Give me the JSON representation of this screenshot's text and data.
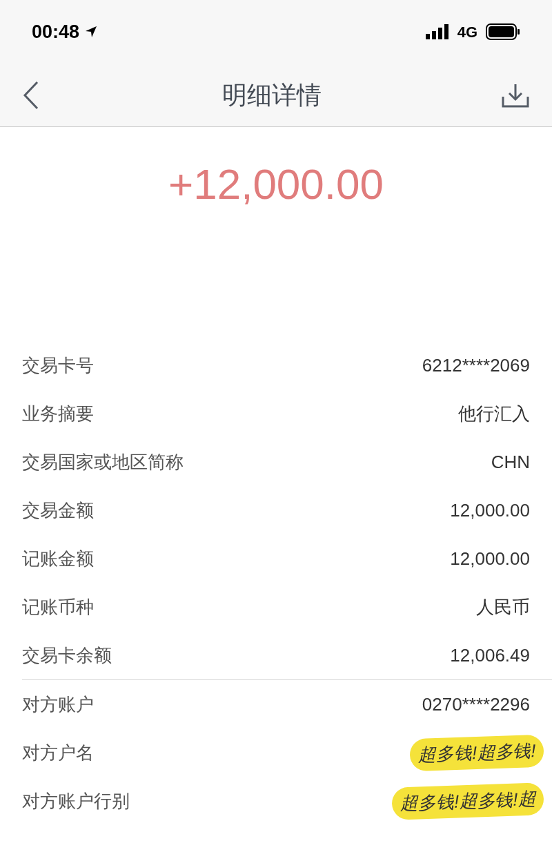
{
  "status_bar": {
    "time": "00:48",
    "network": "4G"
  },
  "nav": {
    "title": "明细详情"
  },
  "amount": "+12,000.00",
  "groups": [
    {
      "rows": [
        {
          "label": "交易卡号",
          "value": "6212****2069"
        },
        {
          "label": "业务摘要",
          "value": "他行汇入"
        },
        {
          "label": "交易国家或地区简称",
          "value": "CHN"
        },
        {
          "label": "交易金额",
          "value": "12,000.00"
        },
        {
          "label": "记账金额",
          "value": "12,000.00"
        },
        {
          "label": "记账币种",
          "value": "人民币"
        },
        {
          "label": "交易卡余额",
          "value": "12,006.49"
        }
      ]
    },
    {
      "rows": [
        {
          "label": "对方账户",
          "value": "0270****2296",
          "redacted": false
        },
        {
          "label": "对方户名",
          "value": "超多钱!超多钱!",
          "redacted": true
        },
        {
          "label": "对方账户行别",
          "value": "超多钱!超多钱!超",
          "redacted": true
        }
      ]
    }
  ]
}
